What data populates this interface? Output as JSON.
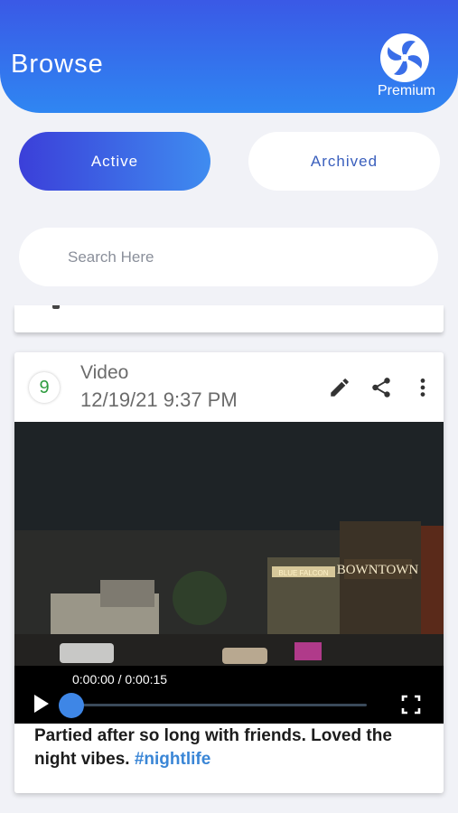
{
  "header": {
    "title": "Browse",
    "premium_label": "Premium"
  },
  "tabs": [
    {
      "label": "Active",
      "selected": true
    },
    {
      "label": "Archived",
      "selected": false
    }
  ],
  "search": {
    "placeholder": "Search Here",
    "value": ""
  },
  "card": {
    "badge": "9",
    "type": "Video",
    "date": "12/19/21 9:37 PM",
    "actions": [
      "pencil-icon",
      "share-icon",
      "more-vertical-icon"
    ],
    "video": {
      "timecode": "0:00:00 / 0:00:15",
      "progress": 0,
      "signs": [
        "BOWNTOWN",
        "BLUE FALCON"
      ]
    },
    "caption_text": "Partied after so long with friends. Loved the night vibes. ",
    "hashtag": "#nightlife"
  },
  "colors": {
    "header_gradient_start": "#3a59e6",
    "header_gradient_end": "#2f86f2",
    "active_tab_start": "#3b3fd9",
    "active_tab_end": "#3f8cf0",
    "badge_text": "#2e9c3f",
    "hashtag": "#3a86d6",
    "background": "#f1f2f7"
  }
}
